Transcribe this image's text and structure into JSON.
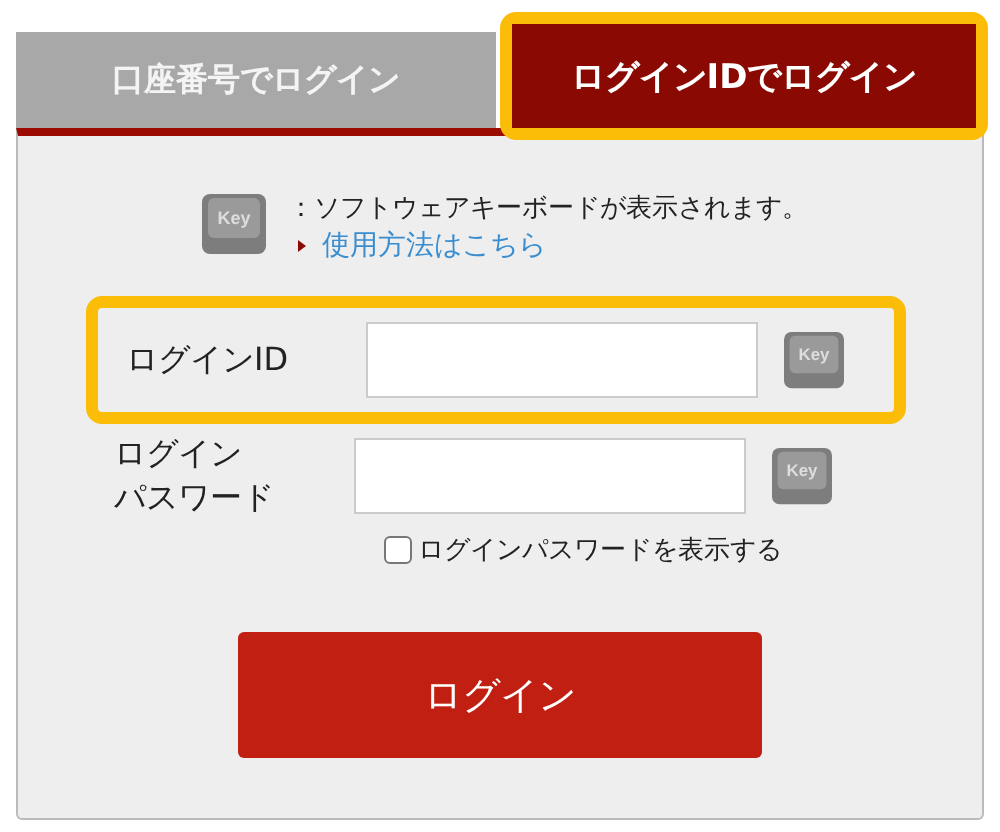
{
  "tabs": [
    {
      "label": "口座番号でログイン",
      "selected": false,
      "highlighted": false
    },
    {
      "label": "ログインIDでログイン",
      "selected": true,
      "highlighted": true
    }
  ],
  "keyboard_note": {
    "key_label": "Key",
    "text": "：ソフトウェアキーボードが表示されます。",
    "link": "使用方法はこちら"
  },
  "fields": [
    {
      "label": [
        "ログインID"
      ],
      "key_label": "Key",
      "highlighted": true
    },
    {
      "label": [
        "ログイン",
        "パスワード"
      ],
      "key_label": "Key",
      "highlighted": false
    }
  ],
  "show_password": {
    "label": "ログインパスワードを表示する",
    "checked": false
  },
  "login_button": "ログイン"
}
